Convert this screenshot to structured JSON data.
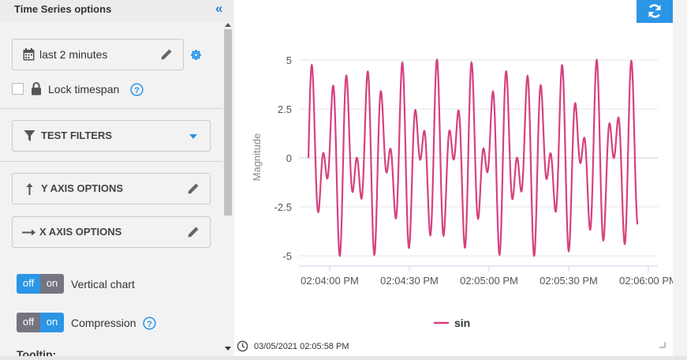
{
  "sidebar": {
    "title": "Time Series options",
    "timerange": "last 2 minutes",
    "lock_label": "Lock timespan",
    "filters_label": "TEST FILTERS",
    "yaxis_label": "Y AXIS OPTIONS",
    "xaxis_label": "X AXIS OPTIONS",
    "vertical_toggle": {
      "off": "off",
      "on": "on",
      "label": "Vertical chart",
      "state": "off"
    },
    "compression_toggle": {
      "off": "off",
      "on": "on",
      "label": "Compression",
      "state": "on"
    },
    "tooltip_label": "Tooltip:"
  },
  "colors": {
    "accent": "#2b95e6",
    "series": "#d6417f",
    "toggle_active": "#2b95e6",
    "toggle_inactive": "#757580"
  },
  "chart_data": {
    "type": "line",
    "ylabel": "Magnitude",
    "ylim": [
      -5,
      5
    ],
    "yticks": [
      "5",
      "2.5",
      "0",
      "-2.5",
      "-5"
    ],
    "xticks": [
      "02:04:00 PM",
      "02:04:30 PM",
      "02:05:00 PM",
      "02:05:30 PM",
      "02:06:00 PM"
    ],
    "xlim_seconds_after_0204": [
      -8,
      116
    ],
    "grid": true,
    "legend": "bottom-center",
    "series": [
      {
        "name": "sin",
        "color": "#d6417f",
        "description": "superposition of sinusoids with peaks at ±5 and smaller local extrema at about ±1.5 and ±3.5",
        "y_range": [
          -5,
          5
        ]
      }
    ]
  },
  "footer": {
    "timestamp": "03/05/2021 02:05:58 PM"
  }
}
